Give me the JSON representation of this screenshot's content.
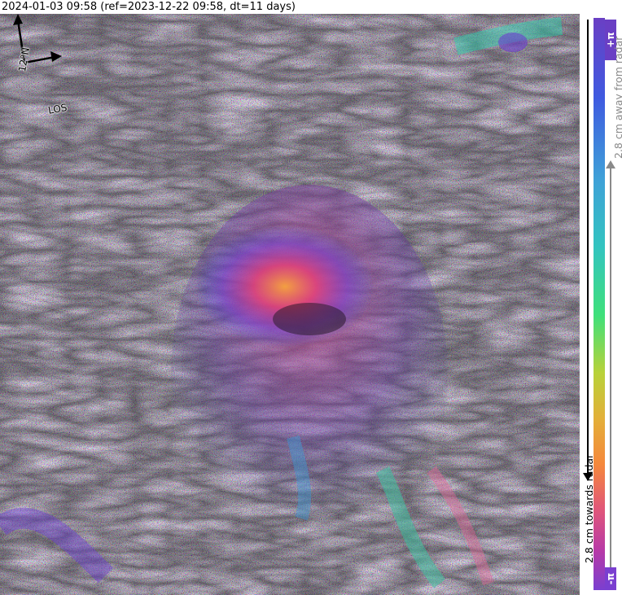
{
  "header": {
    "title": "2024-01-03 09:58 (ref=2023-12-22 09:58, dt=11 days)"
  },
  "compass": {
    "north_label": "12°N",
    "los_label": "LOS"
  },
  "colorbar": {
    "top_symbol": "+π",
    "bottom_symbol": "-π",
    "away_label": "2.8 cm away from radar",
    "towards_label": "2.8 cm towards radar",
    "colors": [
      "#6a3fc4",
      "#3f5ae0",
      "#3fa0d8",
      "#33c4c0",
      "#3fe07a",
      "#b8d23a",
      "#e3b03a",
      "#f5883c",
      "#e0567a",
      "#b83aa6",
      "#7a3fd0"
    ]
  }
}
